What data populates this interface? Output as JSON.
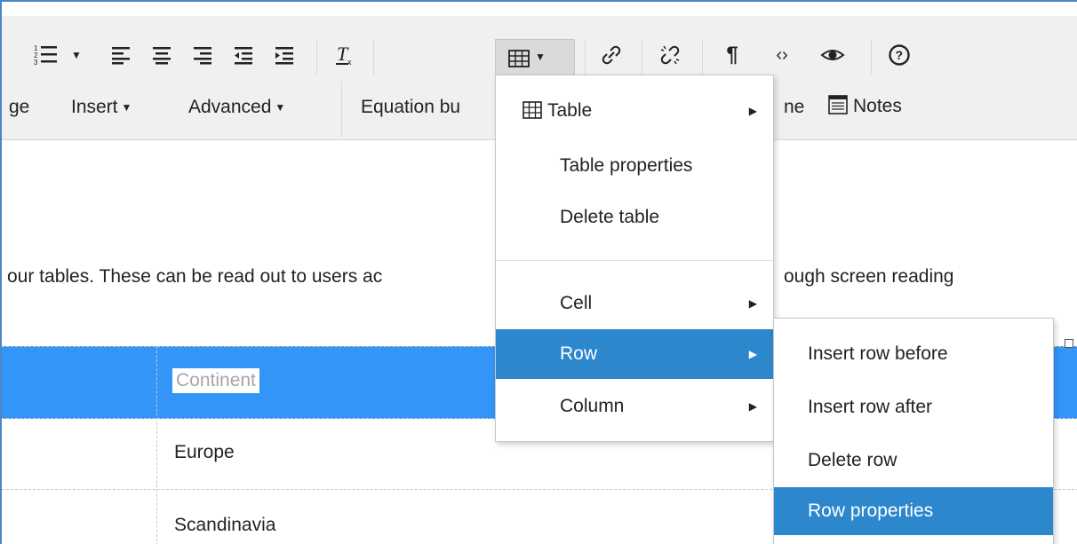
{
  "toolbar": {
    "row1": [
      {
        "name": "numbered-list-icon",
        "glyph": "☰"
      },
      {
        "name": "list-dropdown-icon",
        "glyph": "▾"
      },
      {
        "name": "align-left-icon",
        "glyph": "☰"
      },
      {
        "name": "align-center-icon",
        "glyph": "☰"
      },
      {
        "name": "align-right-icon",
        "glyph": "☰"
      },
      {
        "name": "outdent-icon",
        "glyph": "⇤"
      },
      {
        "name": "indent-icon",
        "glyph": "⇥"
      },
      {
        "name": "clear-formatting-icon",
        "glyph": "T"
      },
      {
        "name": "table-icon",
        "glyph": "▦"
      },
      {
        "name": "link-icon",
        "glyph": "🔗"
      },
      {
        "name": "unlink-icon",
        "glyph": "⛓"
      },
      {
        "name": "paragraph-mark-icon",
        "glyph": "¶"
      },
      {
        "name": "source-code-icon",
        "glyph": "‹›"
      },
      {
        "name": "preview-eye-icon",
        "glyph": "◉"
      },
      {
        "name": "help-icon",
        "glyph": "?"
      }
    ],
    "menubar": {
      "partial_left": "ge",
      "insert": "Insert",
      "advanced": "Advanced",
      "equation": "Equation bu",
      "partial_right": "ne",
      "notes": "Notes"
    }
  },
  "content": {
    "paragraph_left": "our tables. These can be read out to users ac",
    "paragraph_right": "ough screen reading"
  },
  "table": {
    "rows": [
      "Continent",
      "Europe",
      "Scandinavia"
    ]
  },
  "table_menu": {
    "items": [
      {
        "label": "Table",
        "has_submenu": true
      },
      {
        "label": "Table properties",
        "has_submenu": false
      },
      {
        "label": "Delete table",
        "has_submenu": false
      },
      {
        "label": "Cell",
        "has_submenu": true
      },
      {
        "label": "Row",
        "has_submenu": true,
        "selected": true
      },
      {
        "label": "Column",
        "has_submenu": true
      }
    ]
  },
  "row_submenu": {
    "items": [
      {
        "label": "Insert row before"
      },
      {
        "label": "Insert row after"
      },
      {
        "label": "Delete row"
      },
      {
        "label": "Row properties",
        "selected": true
      }
    ]
  },
  "colors": {
    "accent": "#2d87cd",
    "row_highlight": "#3395f8",
    "toolbar_bg": "#f0f0f0"
  }
}
